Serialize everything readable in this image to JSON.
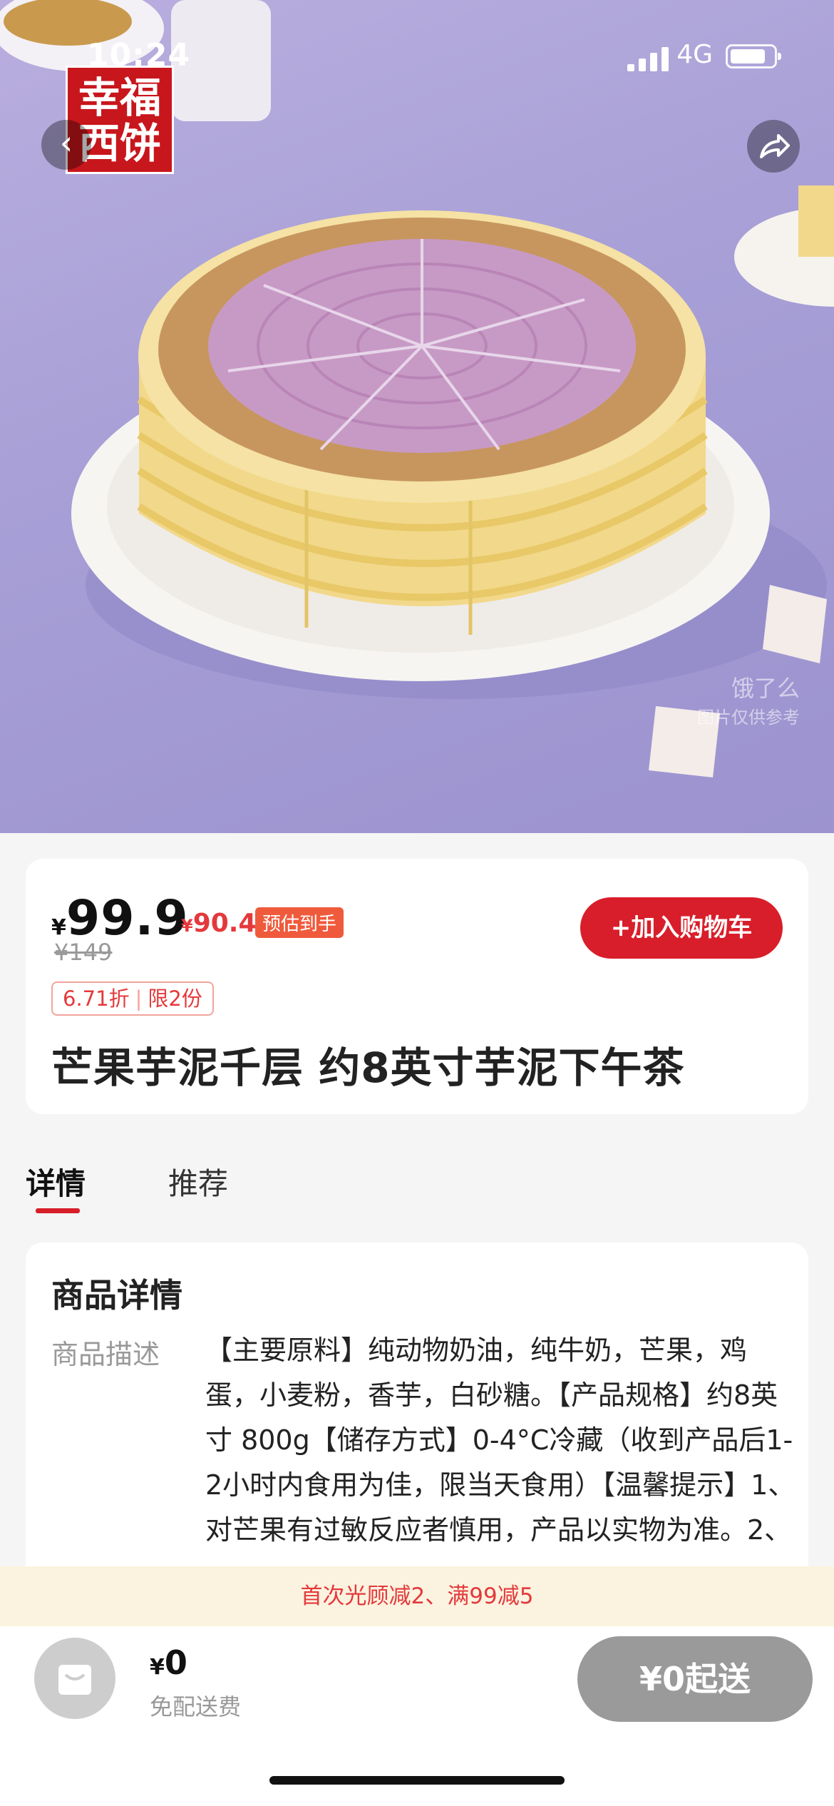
{
  "status_bar": {
    "time": "10:24",
    "network": "4G"
  },
  "brand": {
    "logo_line1": "幸福",
    "logo_line2": "西饼"
  },
  "watermark": {
    "line1": "饿了么",
    "line2": "图片仅供参考"
  },
  "product": {
    "currency": "¥",
    "price": "99.9",
    "estimated_price": "90.4",
    "estimated_label": "预估到手",
    "original_price": "¥149",
    "discount": "6.71折",
    "limit": "限2份",
    "add_to_cart": "+加入购物车",
    "title": "芒果芋泥千层 约8英寸芋泥下午茶"
  },
  "tabs": [
    {
      "label": "详情",
      "active": true
    },
    {
      "label": "推荐",
      "active": false
    }
  ],
  "details": {
    "section_title": "商品详情",
    "desc_label": "商品描述",
    "desc_text": "【主要原料】纯动物奶油，纯牛奶，芒果，鸡蛋，小麦粉，香芋，白砂糖。【产品规格】约8英寸 800g【储存方式】0-4°C冷藏（收到产品后1-2小时内食用为佳，限当天食用）【温馨提示】1、对芒果有过敏反应者慎用，产品以实物为准。2、"
  },
  "coupon_bar": {
    "text": "首次光顾减2、满99减5"
  },
  "bottom_bar": {
    "cart_amount": "0",
    "delivery_note": "免配送费",
    "checkout_label": "¥0起送"
  },
  "colors": {
    "accent_red": "#d81e2a",
    "price_red": "#e4393c",
    "hero_bg": "#a79fd6",
    "disabled_gray": "#9a9a9a"
  },
  "icons": [
    "back-icon",
    "share-icon",
    "shopping-bag-icon",
    "signal-icon",
    "battery-icon"
  ]
}
